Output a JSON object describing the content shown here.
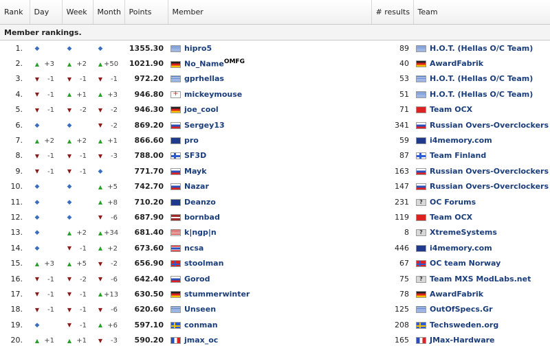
{
  "columns": {
    "rank": "Rank",
    "day": "Day",
    "week": "Week",
    "month": "Month",
    "points": "Points",
    "member": "Member",
    "results": "# results",
    "team": "Team"
  },
  "section_title": "Member rankings.",
  "rows": [
    {
      "rank": "1.",
      "day": {
        "dir": "same",
        "val": ""
      },
      "week": {
        "dir": "same",
        "val": ""
      },
      "month": {
        "dir": "same",
        "val": ""
      },
      "points": "1355.30",
      "member_flag": "gr",
      "member": "hipro5",
      "results": "89",
      "team_flag": "gr",
      "team": "H.O.T. (Hellas O/C Team)"
    },
    {
      "rank": "2.",
      "day": {
        "dir": "up",
        "val": "+3"
      },
      "week": {
        "dir": "up",
        "val": "+2"
      },
      "month": {
        "dir": "up",
        "val": "+50"
      },
      "points": "1021.90",
      "member_flag": "de",
      "member": "No_Name",
      "member_suffix": "OMFG",
      "results": "40",
      "team_flag": "de",
      "team": "AwardFabrik"
    },
    {
      "rank": "3.",
      "day": {
        "dir": "down",
        "val": "-1"
      },
      "week": {
        "dir": "down",
        "val": "-1"
      },
      "month": {
        "dir": "down",
        "val": "-1"
      },
      "points": "972.20",
      "member_flag": "gr",
      "member": "gprhellas",
      "results": "53",
      "team_flag": "gr",
      "team": "H.O.T. (Hellas O/C Team)"
    },
    {
      "rank": "4.",
      "day": {
        "dir": "down",
        "val": "-1"
      },
      "week": {
        "dir": "up",
        "val": "+1"
      },
      "month": {
        "dir": "up",
        "val": "+3"
      },
      "points": "946.80",
      "member_flag": "mk",
      "member": "mickeymouse",
      "results": "51",
      "team_flag": "gr",
      "team": "H.O.T. (Hellas O/C Team)"
    },
    {
      "rank": "5.",
      "day": {
        "dir": "down",
        "val": "-1"
      },
      "week": {
        "dir": "down",
        "val": "-2"
      },
      "month": {
        "dir": "down",
        "val": "-2"
      },
      "points": "946.30",
      "member_flag": "de",
      "member": "joe_cool",
      "results": "71",
      "team_flag": "tw",
      "team": "Team OCX"
    },
    {
      "rank": "6.",
      "day": {
        "dir": "same",
        "val": ""
      },
      "week": {
        "dir": "same",
        "val": ""
      },
      "month": {
        "dir": "down",
        "val": "-2"
      },
      "points": "869.20",
      "member_flag": "ru",
      "member": "Sergey13",
      "results": "341",
      "team_flag": "ru",
      "team": "Russian Overs-Overclockers"
    },
    {
      "rank": "7.",
      "day": {
        "dir": "up",
        "val": "+2"
      },
      "week": {
        "dir": "up",
        "val": "+2"
      },
      "month": {
        "dir": "up",
        "val": "+1"
      },
      "points": "866.60",
      "member_flag": "au",
      "member": "pro",
      "results": "59",
      "team_flag": "au",
      "team": "i4memory.com"
    },
    {
      "rank": "8.",
      "day": {
        "dir": "down",
        "val": "-1"
      },
      "week": {
        "dir": "down",
        "val": "-1"
      },
      "month": {
        "dir": "down",
        "val": "-3"
      },
      "points": "788.00",
      "member_flag": "fi",
      "member": "SF3D",
      "results": "87",
      "team_flag": "fi",
      "team": "Team Finland"
    },
    {
      "rank": "9.",
      "day": {
        "dir": "down",
        "val": "-1"
      },
      "week": {
        "dir": "down",
        "val": "-1"
      },
      "month": {
        "dir": "same",
        "val": ""
      },
      "points": "771.70",
      "member_flag": "ru",
      "member": "Mayk",
      "results": "163",
      "team_flag": "ru",
      "team": "Russian Overs-Overclockers"
    },
    {
      "rank": "10.",
      "day": {
        "dir": "same",
        "val": ""
      },
      "week": {
        "dir": "same",
        "val": ""
      },
      "month": {
        "dir": "up",
        "val": "+5"
      },
      "points": "742.70",
      "member_flag": "ru",
      "member": "Nazar",
      "results": "147",
      "team_flag": "ru",
      "team": "Russian Overs-Overclockers"
    },
    {
      "rank": "11.",
      "day": {
        "dir": "same",
        "val": ""
      },
      "week": {
        "dir": "same",
        "val": ""
      },
      "month": {
        "dir": "up",
        "val": "+8"
      },
      "points": "710.20",
      "member_flag": "nz",
      "member": "Deanzo",
      "results": "231",
      "team_flag": "unk",
      "team": "OC Forums"
    },
    {
      "rank": "12.",
      "day": {
        "dir": "same",
        "val": ""
      },
      "week": {
        "dir": "same",
        "val": ""
      },
      "month": {
        "dir": "down",
        "val": "-6"
      },
      "points": "687.90",
      "member_flag": "lv",
      "member": "bornbad",
      "results": "119",
      "team_flag": "tw",
      "team": "Team OCX"
    },
    {
      "rank": "13.",
      "day": {
        "dir": "same",
        "val": ""
      },
      "week": {
        "dir": "up",
        "val": "+2"
      },
      "month": {
        "dir": "up",
        "val": "+34"
      },
      "points": "681.40",
      "member_flag": "us",
      "member": "k|ngp|n",
      "results": "8",
      "team_flag": "unk",
      "team": "XtremeSystems"
    },
    {
      "rank": "14.",
      "day": {
        "dir": "same",
        "val": ""
      },
      "week": {
        "dir": "down",
        "val": "-1"
      },
      "month": {
        "dir": "up",
        "val": "+2"
      },
      "points": "673.60",
      "member_flag": "th",
      "member": "ncsa",
      "results": "446",
      "team_flag": "au",
      "team": "i4memory.com"
    },
    {
      "rank": "15.",
      "day": {
        "dir": "up",
        "val": "+3"
      },
      "week": {
        "dir": "up",
        "val": "+5"
      },
      "month": {
        "dir": "down",
        "val": "-2"
      },
      "points": "656.90",
      "member_flag": "no",
      "member": "stoolman",
      "results": "67",
      "team_flag": "no",
      "team": "OC team Norway"
    },
    {
      "rank": "16.",
      "day": {
        "dir": "down",
        "val": "-1"
      },
      "week": {
        "dir": "down",
        "val": "-2"
      },
      "month": {
        "dir": "down",
        "val": "-6"
      },
      "points": "642.40",
      "member_flag": "ru",
      "member": "Gorod",
      "results": "75",
      "team_flag": "unk",
      "team": "Team MXS ModLabs.net"
    },
    {
      "rank": "17.",
      "day": {
        "dir": "down",
        "val": "-1"
      },
      "week": {
        "dir": "down",
        "val": "-1"
      },
      "month": {
        "dir": "up",
        "val": "+13"
      },
      "points": "630.50",
      "member_flag": "de",
      "member": "stummerwinter",
      "results": "78",
      "team_flag": "de",
      "team": "AwardFabrik"
    },
    {
      "rank": "18.",
      "day": {
        "dir": "down",
        "val": "-1"
      },
      "week": {
        "dir": "down",
        "val": "-1"
      },
      "month": {
        "dir": "down",
        "val": "-6"
      },
      "points": "620.60",
      "member_flag": "gr",
      "member": "Unseen",
      "results": "125",
      "team_flag": "gr",
      "team": "OutOfSpecs.Gr"
    },
    {
      "rank": "19.",
      "day": {
        "dir": "same",
        "val": ""
      },
      "week": {
        "dir": "down",
        "val": "-1"
      },
      "month": {
        "dir": "up",
        "val": "+6"
      },
      "points": "597.10",
      "member_flag": "se",
      "member": "conman",
      "results": "208",
      "team_flag": "se",
      "team": "Techsweden.org"
    },
    {
      "rank": "20.",
      "day": {
        "dir": "up",
        "val": "+1"
      },
      "week": {
        "dir": "up",
        "val": "+1"
      },
      "month": {
        "dir": "down",
        "val": "-3"
      },
      "points": "590.20",
      "member_flag": "fr",
      "member": "jmax_oc",
      "results": "165",
      "team_flag": "fr",
      "team": "JMax-Hardware"
    }
  ]
}
